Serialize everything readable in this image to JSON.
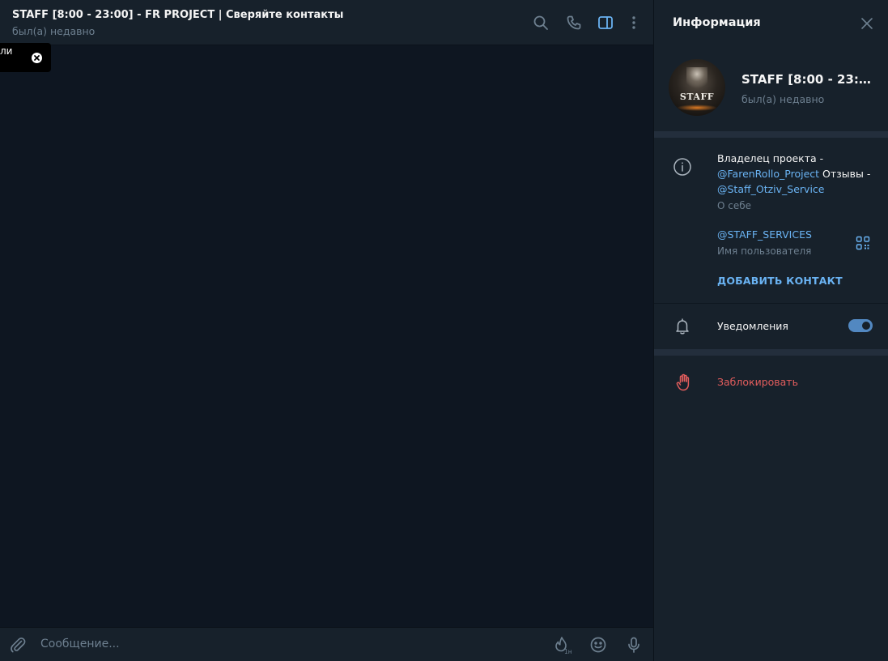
{
  "chat": {
    "title": "STAFF [8:00 - 23:00] - FR PROJECT | Сверяйте контакты",
    "status": "был(а) недавно",
    "header_icons": [
      "search-icon",
      "phone-icon",
      "sidebar-toggle-icon",
      "more-vertical-icon"
    ],
    "toast_text": "ли",
    "composer_placeholder": "Сообщение...",
    "composer_icons": [
      "attach-icon",
      "self-destruct-timer-icon",
      "emoji-icon",
      "microphone-icon"
    ],
    "timer_label": "1н"
  },
  "info": {
    "title": "Информация",
    "avatar_text": "STAFF",
    "name": "STAFF [8:00 - 23:00] ...",
    "status": "был(а) недавно",
    "bio": {
      "part1": "Владелец проекта - ",
      "link1": "@FarenRollo_Project",
      "part2": " Отзывы - ",
      "link2": "@Staff_Otziv_Service",
      "label": "О себе"
    },
    "username": {
      "value": "@STAFF_SERVICES",
      "label": "Имя пользователя"
    },
    "add_contact": "ДОБАВИТЬ КОНТАКТ",
    "notifications": {
      "label": "Уведомления",
      "enabled": true
    },
    "block": "Заблокировать"
  },
  "colors": {
    "accent": "#6ab3f3",
    "toggle": "#5288c1",
    "danger": "#e35d5d",
    "panel": "#17212b",
    "chat_bg": "#0e1621"
  }
}
